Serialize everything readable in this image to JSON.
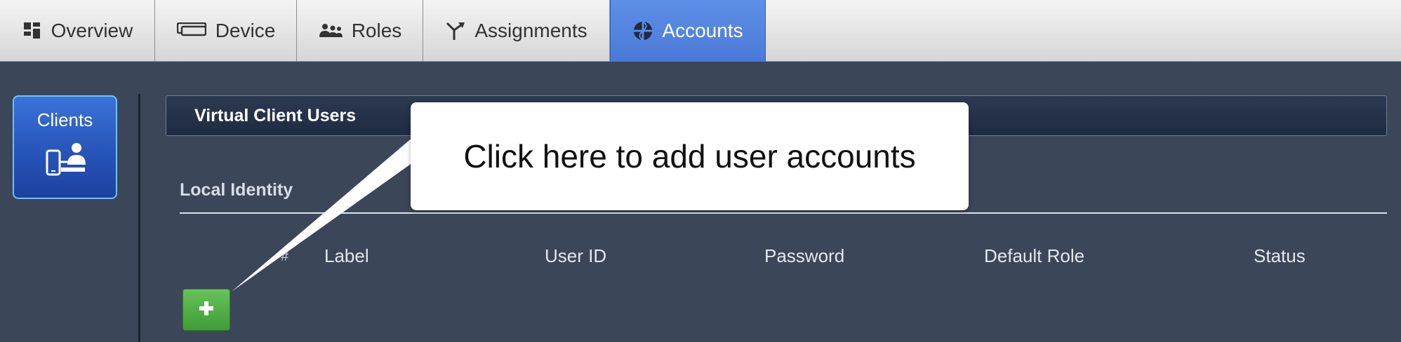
{
  "tabs": [
    {
      "label": "Overview",
      "icon": "grid-icon"
    },
    {
      "label": "Device",
      "icon": "device-icon"
    },
    {
      "label": "Roles",
      "icon": "people-icon"
    },
    {
      "label": "Assignments",
      "icon": "assignment-icon"
    },
    {
      "label": "Accounts",
      "icon": "globe-icon",
      "active": true
    }
  ],
  "sidebar": {
    "tile_label": "Clients",
    "tile_icon": "client-device-user-icon"
  },
  "panel": {
    "title": "Virtual Client Users",
    "section_title": "Local Identity",
    "columns": {
      "hash": "#",
      "label": "Label",
      "user_id": "User ID",
      "password": "Password",
      "default_role": "Default Role",
      "status": "Status"
    },
    "add_button_icon": "plus-icon"
  },
  "callout": {
    "text": "Click here to add user accounts"
  },
  "colors": {
    "background": "#3b4659",
    "active_tab": "#4a7ad8",
    "tile": "#2754b8",
    "add_button": "#3f9d35"
  }
}
